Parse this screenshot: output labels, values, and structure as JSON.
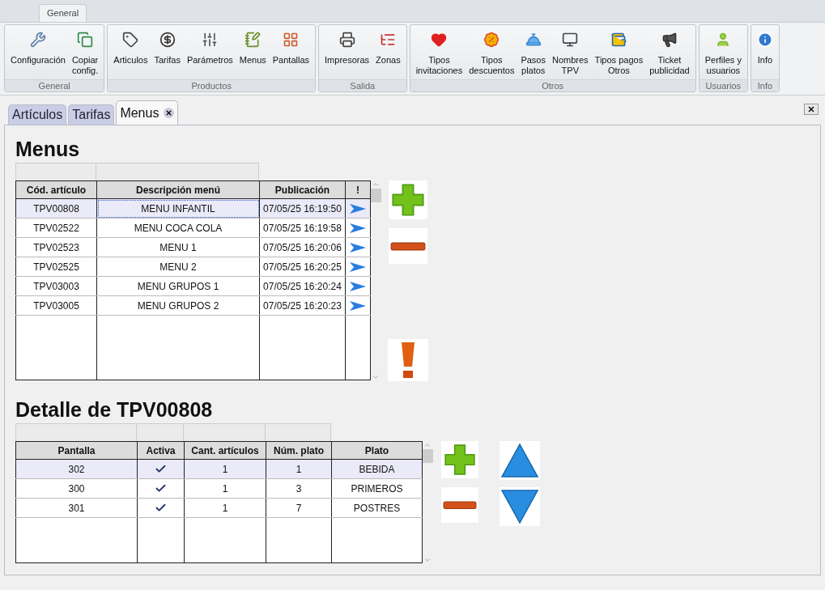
{
  "ribbon": {
    "tabs": [
      {
        "label": "General",
        "selected": true
      }
    ],
    "groups": [
      {
        "title": "General",
        "buttons": [
          "Configuración",
          "Copiar\nconfig."
        ]
      },
      {
        "title": "Productos",
        "buttons": [
          "Articulos",
          "Tarifas",
          "Parámetros",
          "Menus",
          "Pantallas"
        ]
      },
      {
        "title": "Salida",
        "buttons": [
          "Impresoras",
          "Zonas"
        ]
      },
      {
        "title": "Otros",
        "buttons": [
          "Tipos\ninvitaciones",
          "Tipos\ndescuentos",
          "Pasos\nplatos",
          "Nombres\nTPV",
          "Tipos pagos\nOtros",
          "Ticket\npublicidad"
        ]
      },
      {
        "title": "Usuarios",
        "buttons": [
          "Perfiles y\nusuarios"
        ]
      },
      {
        "title": "Info",
        "buttons": [
          "Info"
        ]
      }
    ]
  },
  "doc_tabs": [
    {
      "label": "Artículos",
      "selected": false,
      "closable": false
    },
    {
      "label": "Tarifas",
      "selected": false,
      "closable": false
    },
    {
      "label": "Menus",
      "selected": true,
      "closable": true
    }
  ],
  "menus": {
    "title": "Menus",
    "columns": [
      "Cód. artículo",
      "Descripción menú",
      "Publicación",
      "!"
    ],
    "rows": [
      {
        "code": "TPV00808",
        "description": "MENU INFANTIL",
        "published": "07/05/25 16:19:50",
        "selected": true
      },
      {
        "code": "TPV02522",
        "description": "MENU COCA COLA",
        "published": "07/05/25 16:19:58",
        "selected": false
      },
      {
        "code": "TPV02523",
        "description": "MENU 1",
        "published": "07/05/25 16:20:06",
        "selected": false
      },
      {
        "code": "TPV02525",
        "description": "MENU 2",
        "published": "07/05/25 16:20:25",
        "selected": false
      },
      {
        "code": "TPV03003",
        "description": "MENU GRUPOS 1",
        "published": "07/05/25 16:20:24",
        "selected": false
      },
      {
        "code": "TPV03005",
        "description": "MENU GRUPOS 2",
        "published": "07/05/25 16:20:23",
        "selected": false
      }
    ]
  },
  "detail": {
    "title": "Detalle de TPV00808",
    "columns": [
      "Pantalla",
      "Activa",
      "Cant. artículos",
      "Núm. plato",
      "Plato"
    ],
    "rows": [
      {
        "screen": "302",
        "active": true,
        "count": "1",
        "course_no": "1",
        "course": "BEBIDA",
        "selected": true
      },
      {
        "screen": "300",
        "active": true,
        "count": "1",
        "course_no": "3",
        "course": "PRIMEROS",
        "selected": false
      },
      {
        "screen": "301",
        "active": true,
        "count": "1",
        "course_no": "7",
        "course": "POSTRES",
        "selected": false
      }
    ]
  }
}
